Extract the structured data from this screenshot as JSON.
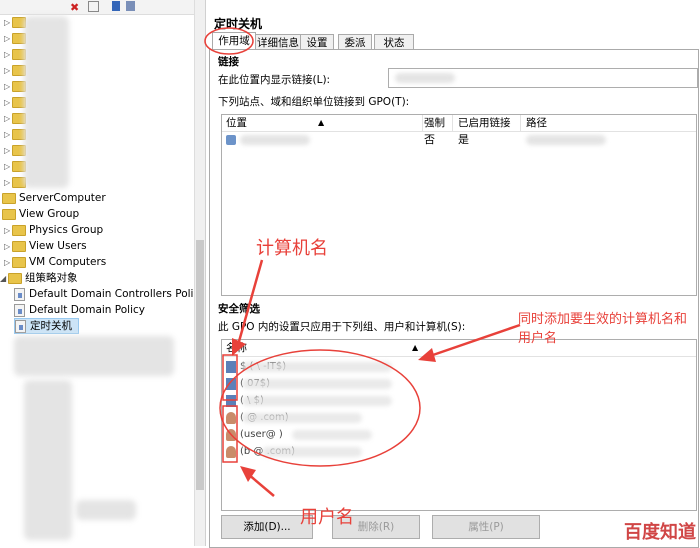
{
  "tree": {
    "items": [
      {
        "label": "ServerComputer"
      },
      {
        "label": "View Group"
      },
      {
        "label": "Physics Group"
      },
      {
        "label": "View Users"
      },
      {
        "label": "VM Computers"
      },
      {
        "label": "组策略对象"
      },
      {
        "label": "Default Domain Controllers Policy"
      },
      {
        "label": "Default Domain Policy"
      },
      {
        "label": "定时关机"
      }
    ]
  },
  "details": {
    "title": "定时关机",
    "tabs": [
      "作用域",
      "详细信息",
      "设置",
      "委派",
      "状态"
    ],
    "links": {
      "section": "链接",
      "location_label": "在此位置内显示链接(L):",
      "list_label": "下列站点、域和组织单位链接到 GPO(T):",
      "columns": [
        "位置",
        "强制",
        "已启用链接",
        "路径"
      ],
      "rows": [
        {
          "enforced": "否",
          "enabled": "是"
        }
      ]
    },
    "security": {
      "section": "安全筛选",
      "desc": "此 GPO 内的设置只应用于下列组、用户和计算机(S):",
      "column": "名称",
      "rows": [
        {
          "text": "$ (        \\    -IT$)",
          "type": "computer"
        },
        {
          "text": "(                    07$)",
          "type": "computer"
        },
        {
          "text": "(                    \\      $)",
          "type": "computer"
        },
        {
          "text": "(             @          .com)",
          "type": "user"
        },
        {
          "text": "(user@                   )",
          "type": "user"
        },
        {
          "text": "(b          @           .com)",
          "type": "user"
        }
      ],
      "buttons": {
        "add": "添加(D)...",
        "remove": "删除(R)",
        "properties": "属性(P)"
      }
    }
  },
  "annotations": {
    "computer_name": "计算机名",
    "both_note": "同时添加要生效的计算机名和用户名",
    "user_name": "用户名"
  },
  "watermark": "百度知道",
  "colors": {
    "annotation": "#e8413a",
    "folder": "#e8c44a"
  }
}
